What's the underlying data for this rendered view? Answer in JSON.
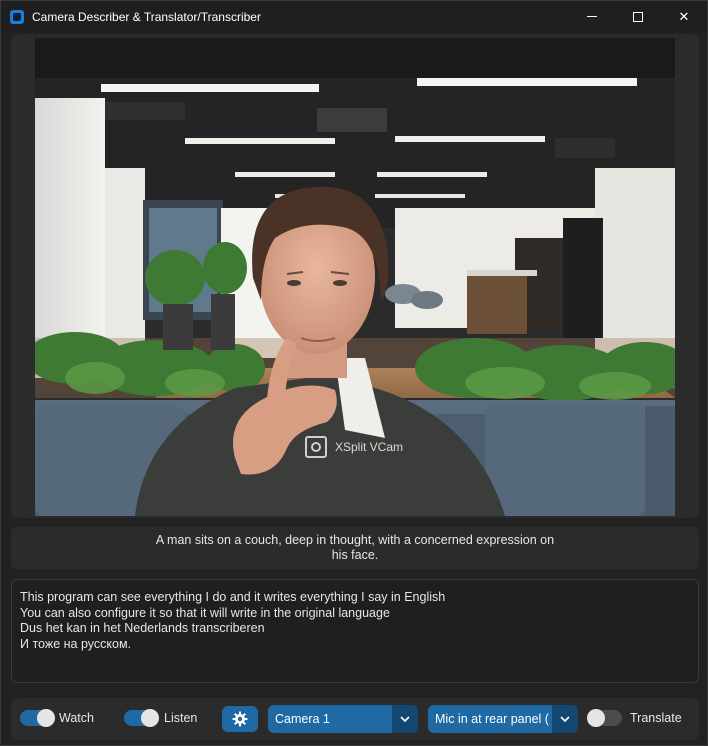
{
  "window": {
    "title": "Camera Describer & Translator/Transcriber",
    "icon": "app-icon",
    "controls": [
      "minimize-icon",
      "maximize-icon",
      "close-icon"
    ],
    "close_glyph": "✕"
  },
  "video": {
    "watermark": "XSplit VCam",
    "accent_background": "#2b2b2b"
  },
  "description": "A man sits on a couch, deep in thought, with a concerned expression on his face.",
  "transcript": {
    "lines": [
      "This program can see everything I do and it writes everything I say in English",
      "You can also configure it so that it will write in the original language",
      "Dus het kan in het Nederlands transcriberen",
      "И тоже на русском."
    ]
  },
  "toolbar": {
    "watch": {
      "label": "Watch",
      "on": true
    },
    "listen": {
      "label": "Listen",
      "on": true
    },
    "settings_icon": "gear-icon",
    "camera_select": "Camera 1",
    "mic_select": "Mic in at rear panel (",
    "translate": {
      "label": "Translate",
      "on": false
    },
    "accent_color": "#1f6aa5",
    "accent_dark": "#144870"
  }
}
